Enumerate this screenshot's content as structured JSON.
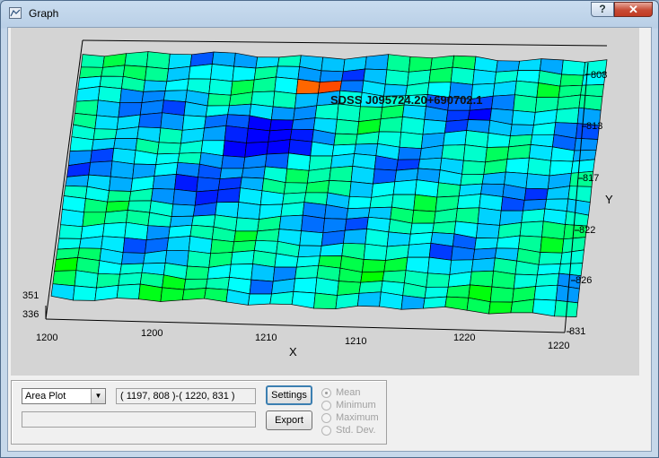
{
  "window": {
    "title": "Graph",
    "help_label": "?",
    "close_label": "✕"
  },
  "plot": {
    "label": "SDSS J095724.20+690702.1",
    "x_label": "X",
    "y_label": "Y",
    "x_ticks_front": [
      "1200",
      "1210",
      "1220"
    ],
    "x_ticks_mid": [
      "1200",
      "1210"
    ],
    "y_ticks": [
      "808",
      "813",
      "817",
      "822",
      "826",
      "831"
    ],
    "z_ticks": [
      "351",
      "336"
    ],
    "colors": {
      "low": "#0000ff",
      "mid": "#00ffff",
      "high": "#00ff00",
      "peak": "#ff6600",
      "background": "#d4d4d4"
    }
  },
  "controls": {
    "plot_type": "Area Plot",
    "range_text": "( 1197, 808 )-( 1220, 831 )",
    "status_text": "",
    "settings_label": "Settings",
    "export_label": "Export",
    "stats": [
      {
        "label": "Mean",
        "selected": true
      },
      {
        "label": "Minimum",
        "selected": false
      },
      {
        "label": "Maximum",
        "selected": false
      },
      {
        "label": "Std. Dev.",
        "selected": false
      }
    ]
  }
}
